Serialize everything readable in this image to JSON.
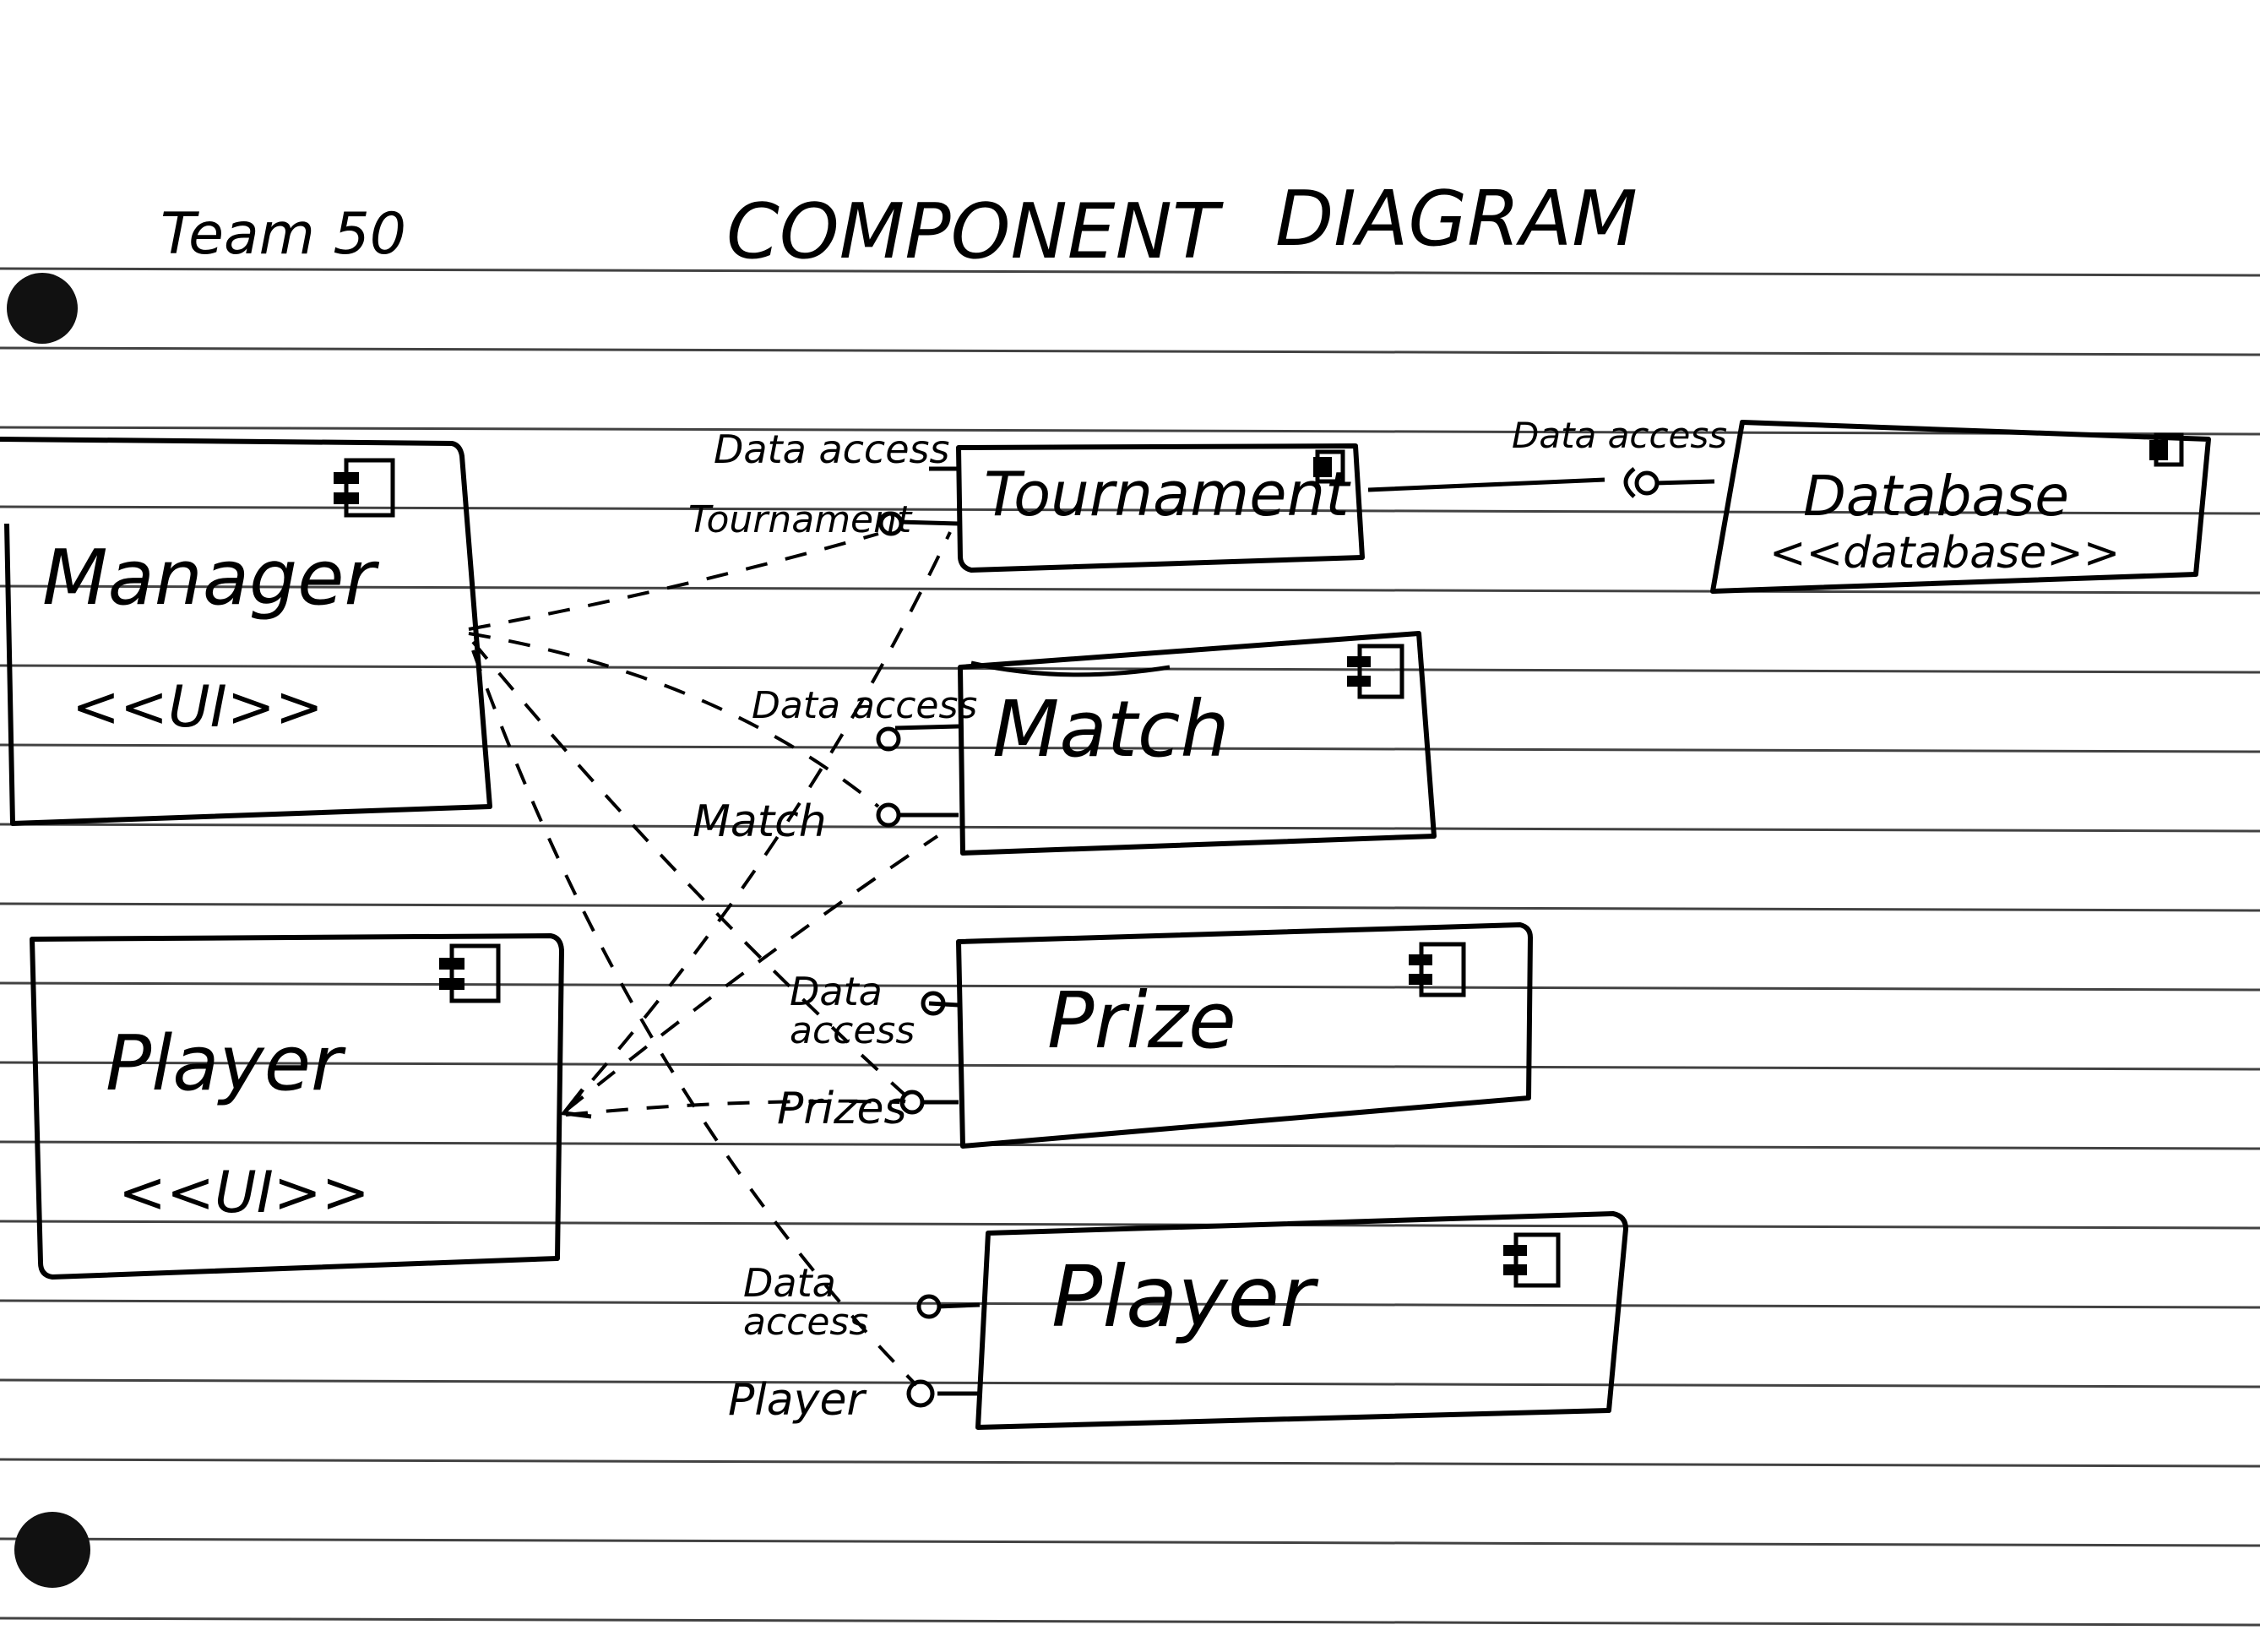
{
  "header": {
    "team": "Team 50",
    "title_word1": "COMPONENT",
    "title_word2": "DIAGRAM"
  },
  "components": {
    "manager": {
      "name": "Manager",
      "stereotype": "<<UI>>"
    },
    "player_ui": {
      "name": "Player",
      "stereotype": "<<UI>>"
    },
    "tournament": {
      "name": "Tournament"
    },
    "match": {
      "name": "Match"
    },
    "prize": {
      "name": "Prize"
    },
    "player": {
      "name": "Player"
    },
    "database": {
      "name": "Database",
      "stereotype": "<<database>>"
    }
  },
  "interfaces": {
    "tournament_data": "Data access",
    "tournament_provided": "Tournament",
    "database_data": "Data access",
    "match_data": "Data access",
    "match_provided": "Match",
    "prize_data_1": "Data",
    "prize_data_2": "access",
    "prize_provided": "Prizes",
    "player_data_1": "Data",
    "player_data_2": "access",
    "player_provided": "Player"
  },
  "colors": {
    "ink": "#000000",
    "paper": "#ffffff"
  },
  "icons": {
    "component": "component-icon"
  }
}
